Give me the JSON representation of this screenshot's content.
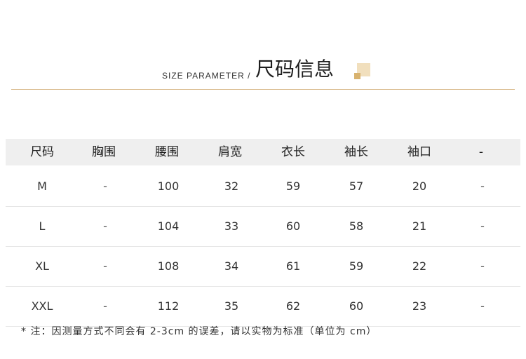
{
  "header": {
    "title_en": "SIZE PARAMETER /",
    "title_cn": "尺码信息",
    "accent_colors": {
      "light": "#f1dfbd",
      "dark": "#d8b26e",
      "divider": "#d9b98a"
    }
  },
  "table": {
    "columns": [
      "尺码",
      "胸围",
      "腰围",
      "肩宽",
      "衣长",
      "袖长",
      "袖口",
      "-"
    ],
    "rows": [
      [
        "M",
        "-",
        "100",
        "32",
        "59",
        "57",
        "20",
        "-"
      ],
      [
        "L",
        "-",
        "104",
        "33",
        "60",
        "58",
        "21",
        "-"
      ],
      [
        "XL",
        "-",
        "108",
        "34",
        "61",
        "59",
        "22",
        "-"
      ],
      [
        "XXL",
        "-",
        "112",
        "35",
        "62",
        "60",
        "23",
        "-"
      ]
    ]
  },
  "footnote": "* 注：因测量方式不同会有 2-3cm 的误差，请以实物为标准（单位为 cm）"
}
